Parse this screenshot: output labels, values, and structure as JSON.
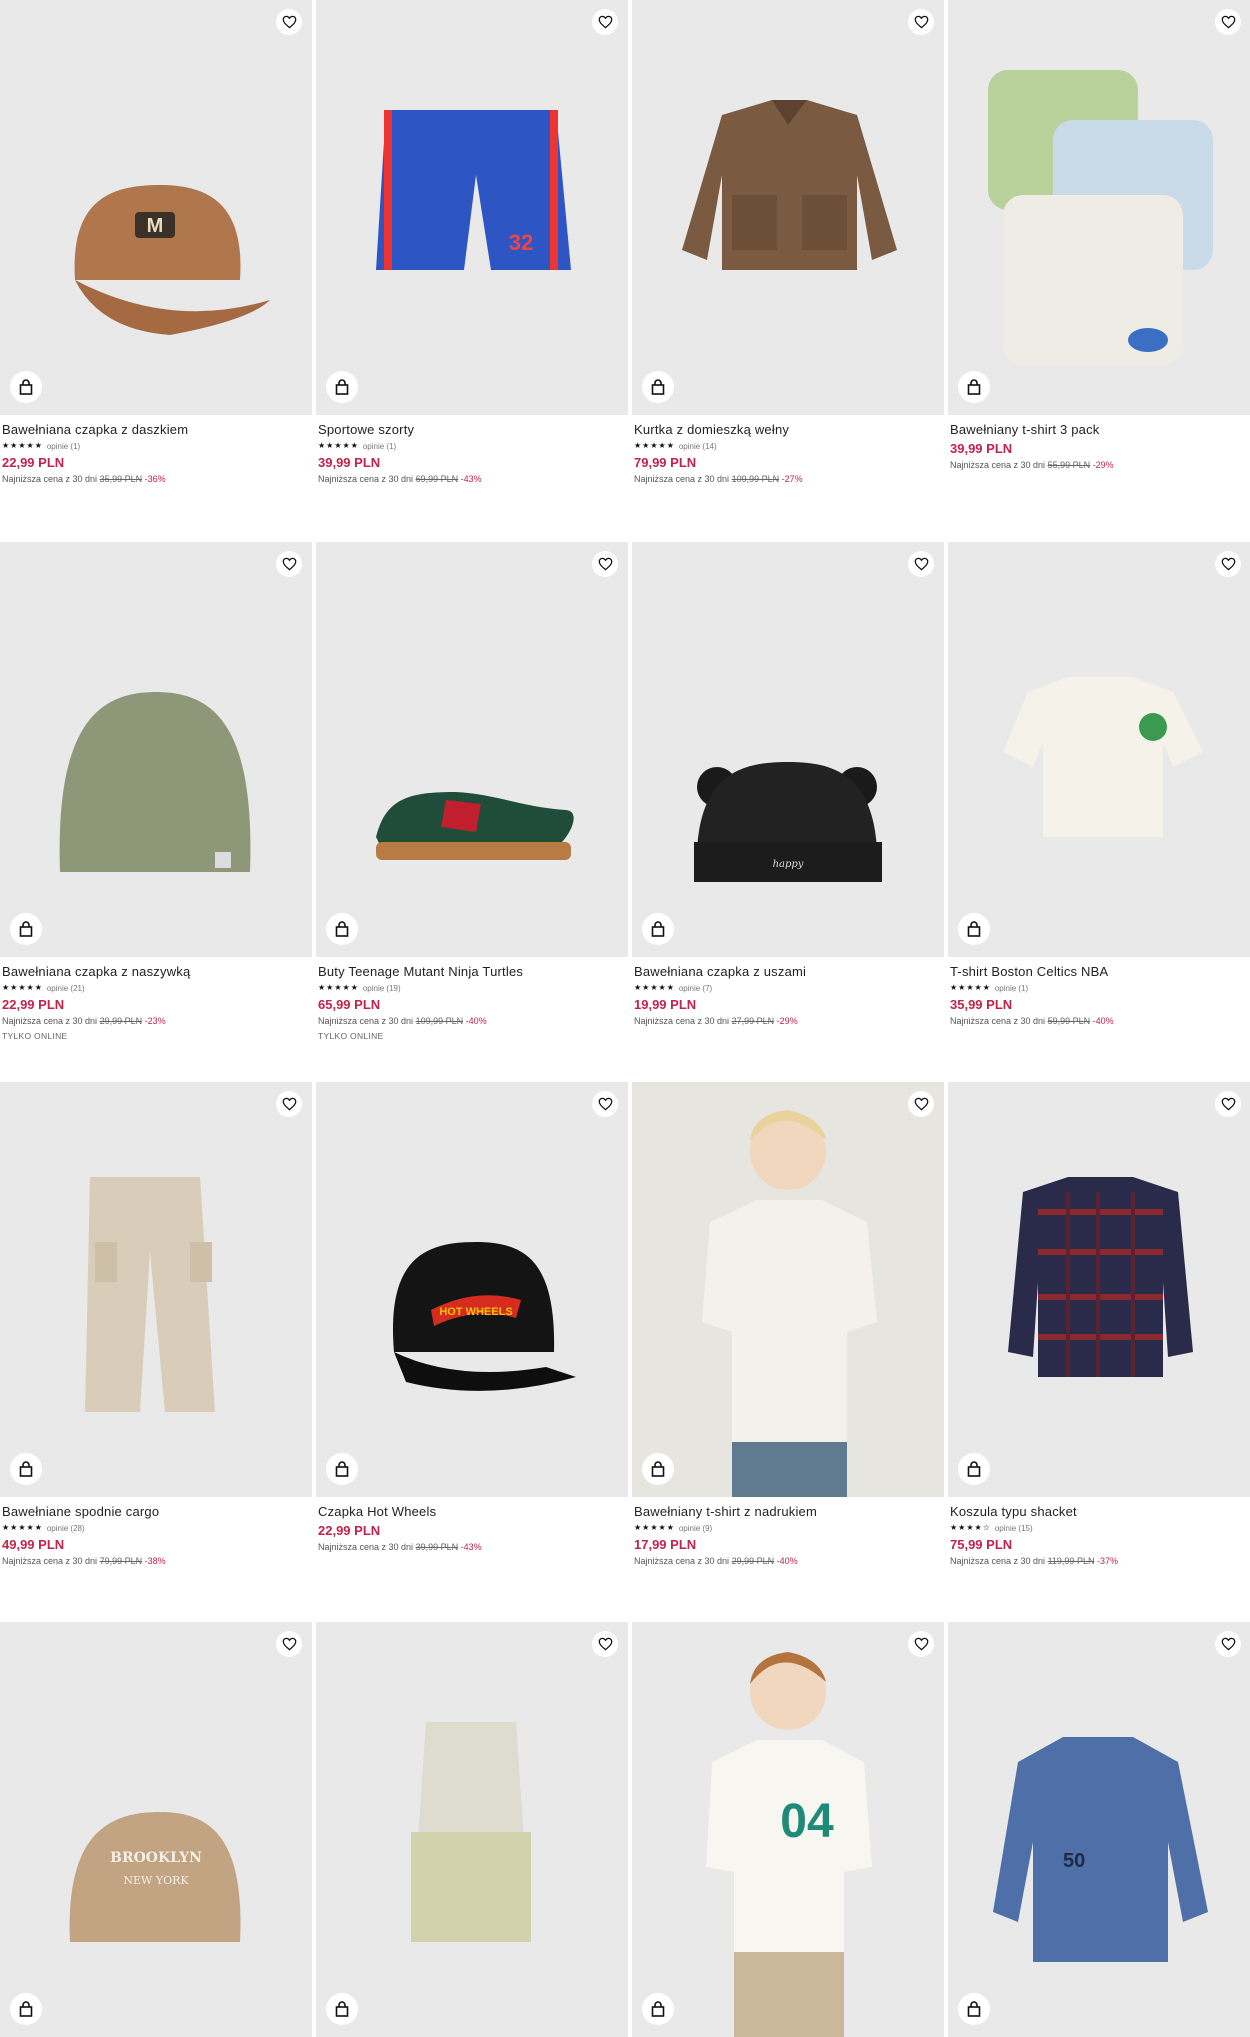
{
  "lowest_label": "Najniższa cena z 30 dni",
  "products": [
    {
      "name": "Bawełniana czapka z daszkiem",
      "stars": "★★★★★",
      "reviews": "opinie (1)",
      "price": "22,99 PLN",
      "old": "35,99 PLN",
      "disc": "-36%",
      "online": ""
    },
    {
      "name": "Sportowe szorty",
      "stars": "★★★★★",
      "reviews": "opinie (1)",
      "price": "39,99 PLN",
      "old": "69,99 PLN",
      "disc": "-43%",
      "online": ""
    },
    {
      "name": "Kurtka z domieszką wełny",
      "stars": "★★★★★",
      "reviews": "opinie (14)",
      "price": "79,99 PLN",
      "old": "109,99 PLN",
      "disc": "-27%",
      "online": ""
    },
    {
      "name": "Bawełniany t-shirt 3 pack",
      "stars": "",
      "reviews": "",
      "price": "39,99 PLN",
      "old": "55,99 PLN",
      "disc": "-29%",
      "online": ""
    },
    {
      "name": "Bawełniana czapka z naszywką",
      "stars": "★★★★★",
      "reviews": "opinie (21)",
      "price": "22,99 PLN",
      "old": "29,99 PLN",
      "disc": "-23%",
      "online": "TYLKO ONLINE"
    },
    {
      "name": "Buty Teenage Mutant Ninja Turtles",
      "stars": "★★★★★",
      "reviews": "opinie (19)",
      "price": "65,99 PLN",
      "old": "109,99 PLN",
      "disc": "-40%",
      "online": "TYLKO ONLINE"
    },
    {
      "name": "Bawełniana czapka z uszami",
      "stars": "★★★★★",
      "reviews": "opinie (7)",
      "price": "19,99 PLN",
      "old": "27,99 PLN",
      "disc": "-29%",
      "online": ""
    },
    {
      "name": "T-shirt Boston Celtics NBA",
      "stars": "★★★★★",
      "reviews": "opinie (1)",
      "price": "35,99 PLN",
      "old": "59,99 PLN",
      "disc": "-40%",
      "online": ""
    },
    {
      "name": "Bawełniane spodnie cargo",
      "stars": "★★★★★",
      "reviews": "opinie (28)",
      "price": "49,99 PLN",
      "old": "79,99 PLN",
      "disc": "-38%",
      "online": ""
    },
    {
      "name": "Czapka Hot Wheels",
      "stars": "",
      "reviews": "",
      "price": "22,99 PLN",
      "old": "39,99 PLN",
      "disc": "-43%",
      "online": ""
    },
    {
      "name": "Bawełniany t-shirt z nadrukiem",
      "stars": "★★★★★",
      "reviews": "opinie (9)",
      "price": "17,99 PLN",
      "old": "29,99 PLN",
      "disc": "-40%",
      "online": ""
    },
    {
      "name": "Koszula typu shacket",
      "stars": "★★★★☆",
      "reviews": "opinie (15)",
      "price": "75,99 PLN",
      "old": "119,99 PLN",
      "disc": "-37%",
      "online": ""
    }
  ],
  "icons": {
    "favorite": "heart-icon",
    "bag": "shopping-bag-icon"
  },
  "colors": {
    "price": "#c2234a",
    "tile_bg": "#e9e9e9"
  }
}
